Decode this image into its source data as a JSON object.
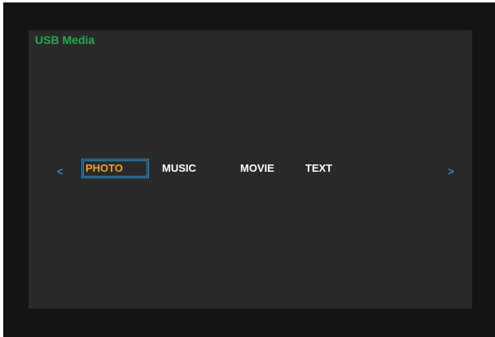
{
  "screen": {
    "title": "USB Media"
  },
  "navigation": {
    "prev_label": "<",
    "next_label": ">"
  },
  "tabs": [
    {
      "label": "PHOTO",
      "selected": true
    },
    {
      "label": "MUSIC",
      "selected": false
    },
    {
      "label": "MOVIE",
      "selected": false
    },
    {
      "label": "TEXT",
      "selected": false
    }
  ],
  "colors": {
    "title": "#1eae4a",
    "selected_text": "#f0a318",
    "focus_border": "#1f97d6",
    "arrow": "#1f97d6",
    "panel": "#292929",
    "background": "#141414"
  }
}
